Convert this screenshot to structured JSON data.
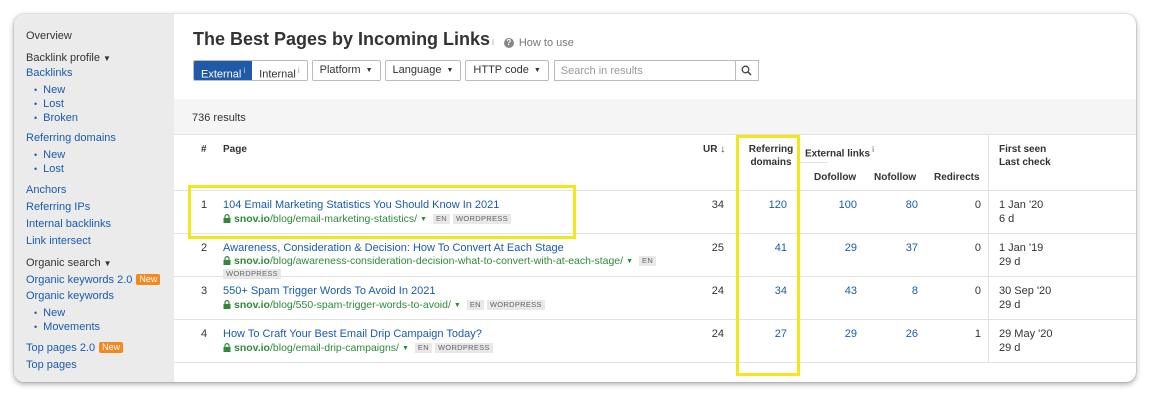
{
  "sidebar": {
    "overview": "Overview",
    "backlink_profile": "Backlink profile",
    "backlinks": "Backlinks",
    "backlinks_sub": [
      "New",
      "Lost",
      "Broken"
    ],
    "referring_domains": "Referring domains",
    "referring_domains_sub": [
      "New",
      "Lost"
    ],
    "links": [
      "Anchors",
      "Referring IPs",
      "Internal backlinks",
      "Link intersect"
    ],
    "organic_search": "Organic search",
    "organic_keywords_2": "Organic keywords 2.0",
    "organic_keywords": "Organic keywords",
    "organic_keywords_sub": [
      "New",
      "Movements"
    ],
    "top_pages_2": "Top pages 2.0",
    "top_pages": "Top pages",
    "new_badge": "New"
  },
  "header": {
    "title": "The Best Pages by Incoming Links",
    "info_mark": "i",
    "how_to_use": "How to use"
  },
  "filters": {
    "external": "External",
    "internal": "Internal",
    "platform": "Platform",
    "language": "Language",
    "http_code": "HTTP code",
    "search_placeholder": "Search in results"
  },
  "results_count": "736 results",
  "columns": {
    "num": "#",
    "page": "Page",
    "ur": "UR",
    "ref_domains_1": "Referring",
    "ref_domains_2": "domains",
    "external_links": "External links",
    "dofollow": "Dofollow",
    "nofollow": "Nofollow",
    "redirects": "Redirects",
    "first_seen": "First seen",
    "last_check": "Last check"
  },
  "rows": [
    {
      "num": "1",
      "title": "104 Email Marketing Statistics You Should Know In 2021",
      "domain": "snov.io",
      "path": "/blog/email-marketing-statistics/",
      "lang": "EN",
      "platform": "WORDPRESS",
      "ur": "34",
      "ref_domains": "120",
      "dofollow": "100",
      "nofollow": "80",
      "redirects": "0",
      "first_seen": "1 Jan '20",
      "last_check": "6 d"
    },
    {
      "num": "2",
      "title": "Awareness, Consideration & Decision: How To Convert At Each Stage",
      "domain": "snov.io",
      "path": "/blog/awareness-consideration-decision-what-to-convert-with-at-each-stage/",
      "lang": "EN",
      "platform": "WORDPRESS",
      "ur": "25",
      "ref_domains": "41",
      "dofollow": "29",
      "nofollow": "37",
      "redirects": "0",
      "first_seen": "1 Jan '19",
      "last_check": "29 d"
    },
    {
      "num": "3",
      "title": "550+ Spam Trigger Words To Avoid In 2021",
      "domain": "snov.io",
      "path": "/blog/550-spam-trigger-words-to-avoid/",
      "lang": "EN",
      "platform": "WORDPRESS",
      "ur": "24",
      "ref_domains": "34",
      "dofollow": "43",
      "nofollow": "8",
      "redirects": "0",
      "first_seen": "30 Sep '20",
      "last_check": "29 d"
    },
    {
      "num": "4",
      "title": "How To Craft Your Best Email Drip Campaign Today?",
      "domain": "snov.io",
      "path": "/blog/email-drip-campaigns/",
      "lang": "EN",
      "platform": "WORDPRESS",
      "ur": "24",
      "ref_domains": "27",
      "dofollow": "29",
      "nofollow": "26",
      "redirects": "1",
      "first_seen": "29 May '20",
      "last_check": "29 d"
    }
  ],
  "colors": {
    "link": "#1a5bab",
    "url_green": "#2c8a3a",
    "active_tab": "#1e5aa8",
    "highlight": "#f2e71a",
    "new_badge": "#f5871f",
    "sidebar_bg": "#ebebeb"
  }
}
